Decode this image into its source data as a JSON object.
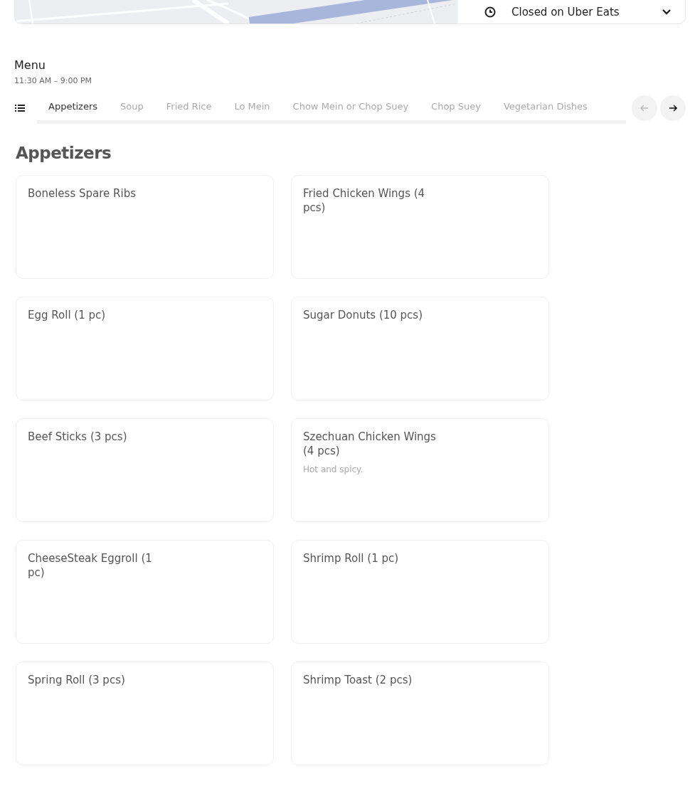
{
  "store_panel": {
    "status": "Closed on Uber Eats"
  },
  "menu": {
    "title": "Menu",
    "hours": "11:30 AM – 9:00 PM"
  },
  "tabs": [
    {
      "label": "Appetizers",
      "selected": true
    },
    {
      "label": "Soup",
      "selected": false
    },
    {
      "label": "Fried Rice",
      "selected": false
    },
    {
      "label": "Lo Mein",
      "selected": false
    },
    {
      "label": "Chow Mein or Chop Suey",
      "selected": false
    },
    {
      "label": "Chop Suey",
      "selected": false
    },
    {
      "label": "Vegetarian Dishes",
      "selected": false
    }
  ],
  "scroll_buttons": [
    {
      "kind": "back",
      "disabled": true
    },
    {
      "kind": "forward",
      "disabled": false
    }
  ],
  "section": {
    "title": "Appetizers",
    "items": [
      {
        "name": "Boneless Spare Ribs"
      },
      {
        "name": "Fried Chicken Wings (4 pcs)"
      },
      {
        "name": "Egg Roll (1 pc)"
      },
      {
        "name": "Sugar Donuts (10 pcs)"
      },
      {
        "name": "Beef Sticks (3 pcs)"
      },
      {
        "name": "Szechuan Chicken Wings (4 pcs)",
        "description": "Hot and spicy."
      },
      {
        "name": "CheeseSteak Eggroll (1 pc)"
      },
      {
        "name": "Shrimp Roll (1 pc)"
      },
      {
        "name": "Spring Roll (3 pcs)"
      },
      {
        "name": "Shrimp Toast (2 pcs)"
      }
    ]
  }
}
